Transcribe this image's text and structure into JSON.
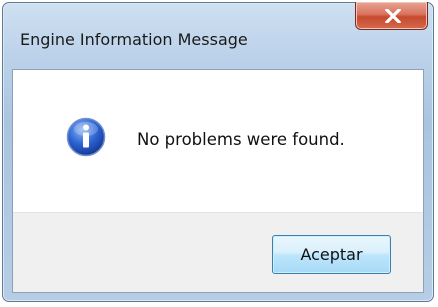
{
  "window": {
    "title": "Engine Information Message"
  },
  "dialog": {
    "message": "No problems were found.",
    "icon": "information-icon",
    "accept_label": "Aceptar"
  }
}
